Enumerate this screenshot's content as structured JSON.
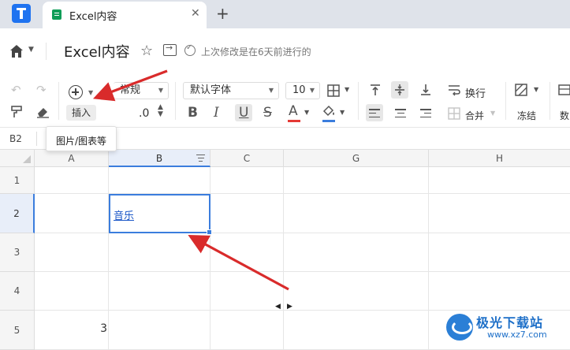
{
  "browser": {
    "tab_title": "Excel内容",
    "tab_close": "✕",
    "new_tab": "+"
  },
  "titlebar": {
    "doc_title": "Excel内容",
    "saved_status": "上次修改是在6天前进行的"
  },
  "toolbar": {
    "insert_label": "插入",
    "number_format": "常规",
    "decimal_label": ".0",
    "font_family": "默认字体",
    "font_size": "10",
    "bold": "B",
    "italic": "I",
    "underline": "U",
    "strike": "S",
    "text_color_glyph": "A",
    "text_color": "#e53935",
    "fill_color": "#3b7ddd",
    "wrap_label": "换行",
    "merge_label": "合并",
    "freeze_label": "冻结",
    "more_label": "数"
  },
  "formula": {
    "cell_ref": "B2"
  },
  "tooltip": {
    "text": "图片/图表等"
  },
  "grid": {
    "columns": [
      "A",
      "B",
      "C",
      "G",
      "H"
    ],
    "rows": [
      "1",
      "2",
      "3",
      "4",
      "5"
    ],
    "selected_cell": "B2",
    "cells": {
      "B2": "音乐",
      "A5": "3"
    }
  },
  "watermark": {
    "title": "极光下载站",
    "url": "www.xz7.com"
  },
  "colors": {
    "accent": "#3b7ddd",
    "arrow": "#d92b2b",
    "tab_bar": "#dfe3ea"
  }
}
